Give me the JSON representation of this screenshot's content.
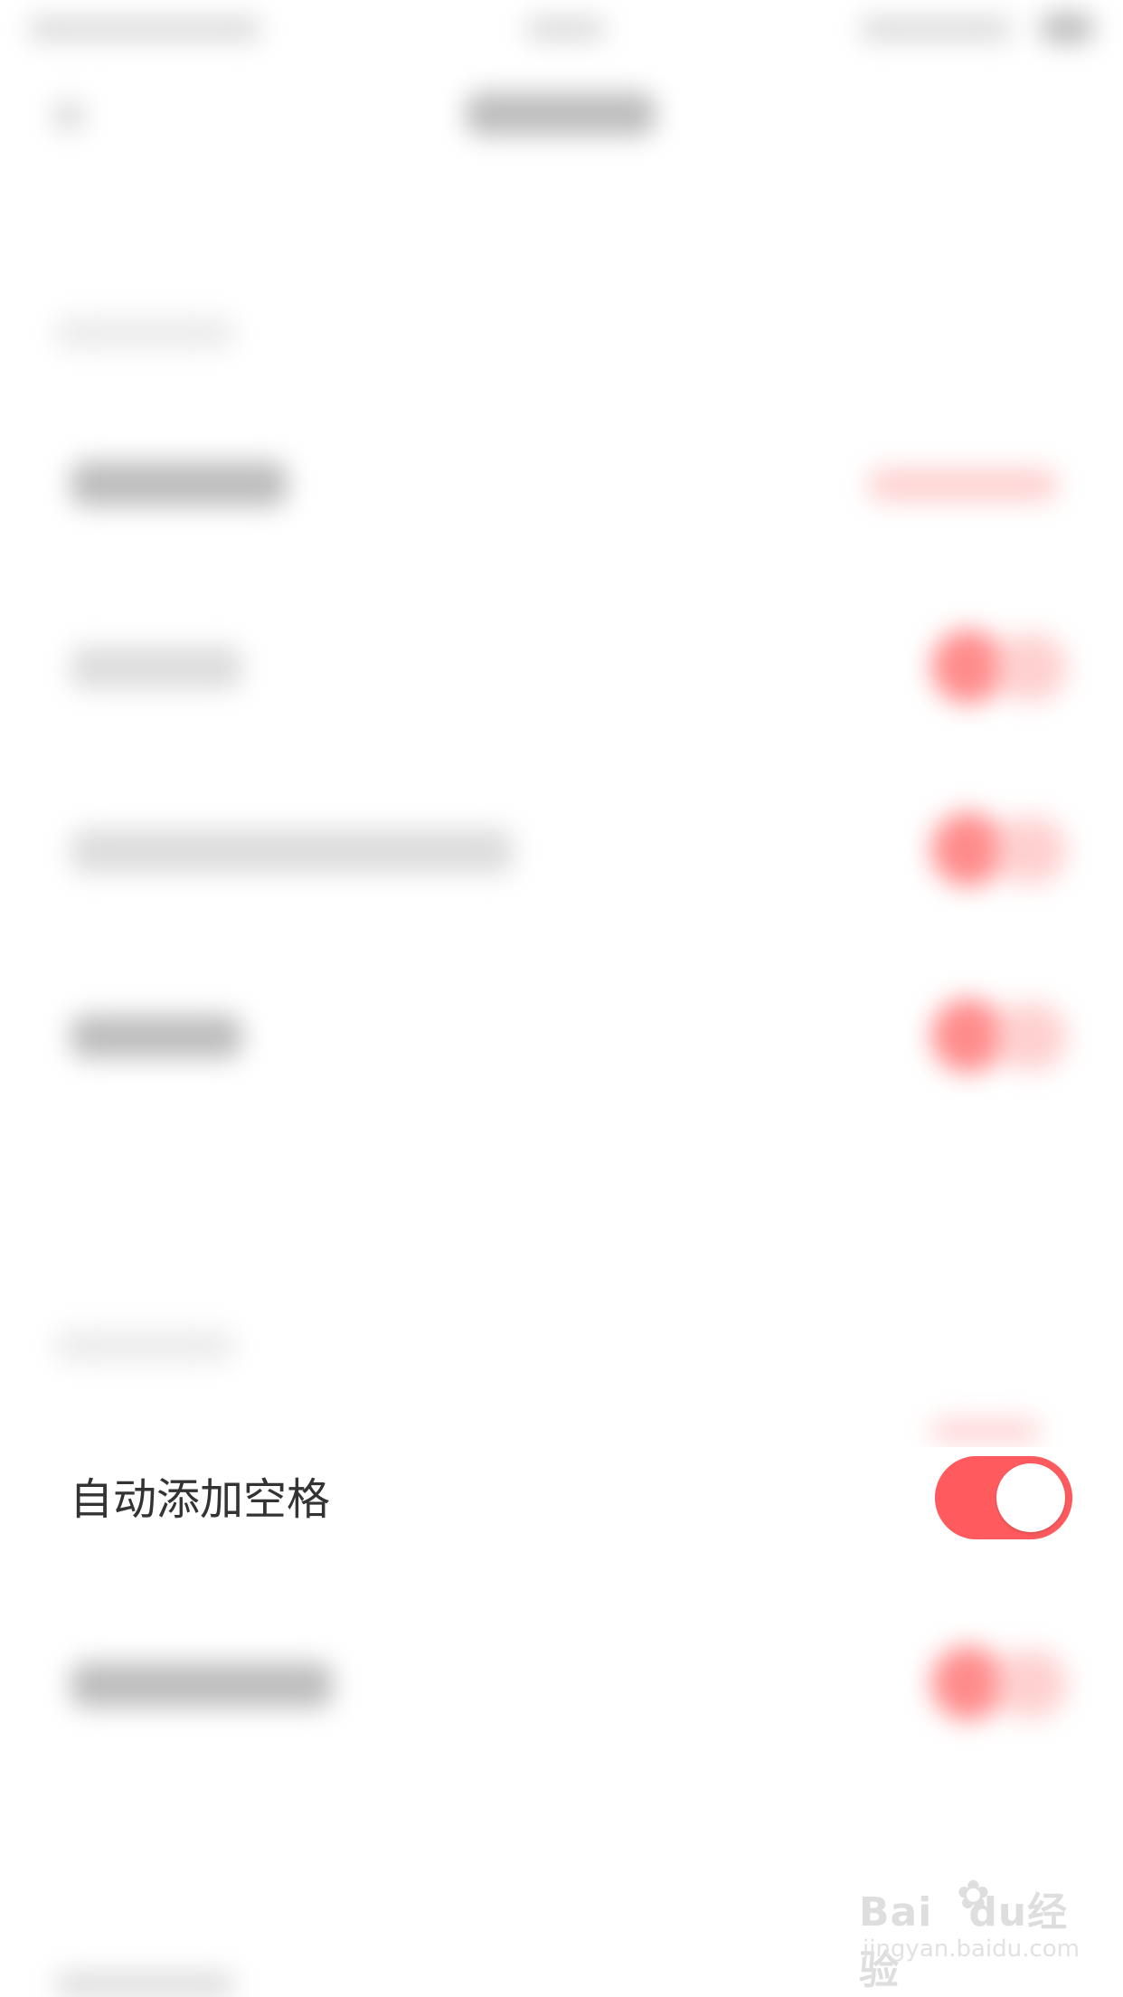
{
  "settings": {
    "rows": [
      {
        "label": "自动添加空格",
        "toggle_on": true
      }
    ]
  },
  "colors": {
    "accent": "#ff5b5f",
    "text": "#333333",
    "background": "#ffffff"
  },
  "watermark": {
    "brand": "Bai",
    "brand_icon": "paw-icon",
    "brand_suffix": "du经验",
    "url": "jingyan.baidu.com"
  }
}
